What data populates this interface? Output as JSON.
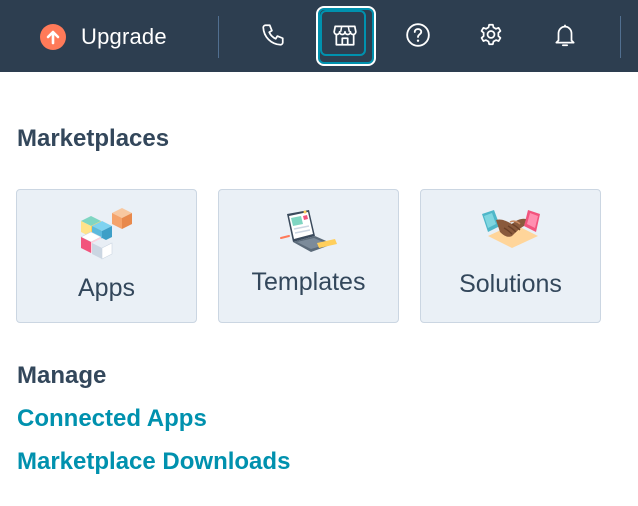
{
  "topbar": {
    "upgrade_label": "Upgrade",
    "icons": [
      "phone-icon",
      "marketplace-store-icon",
      "help-icon",
      "settings-icon",
      "notifications-bell-icon"
    ]
  },
  "marketplaces": {
    "heading": "Marketplaces",
    "cards": [
      {
        "label": "Apps",
        "icon": "apps-cubes-illustration"
      },
      {
        "label": "Templates",
        "icon": "templates-laptop-illustration"
      },
      {
        "label": "Solutions",
        "icon": "solutions-handshake-illustration"
      }
    ]
  },
  "manage": {
    "heading": "Manage",
    "links": [
      "Connected Apps",
      "Marketplace Downloads"
    ]
  },
  "colors": {
    "topbar_bg": "#2d3e50",
    "upgrade_accent": "#ff7a59",
    "link": "#0091ae",
    "card_bg": "#eaf0f6",
    "text": "#33475b"
  }
}
